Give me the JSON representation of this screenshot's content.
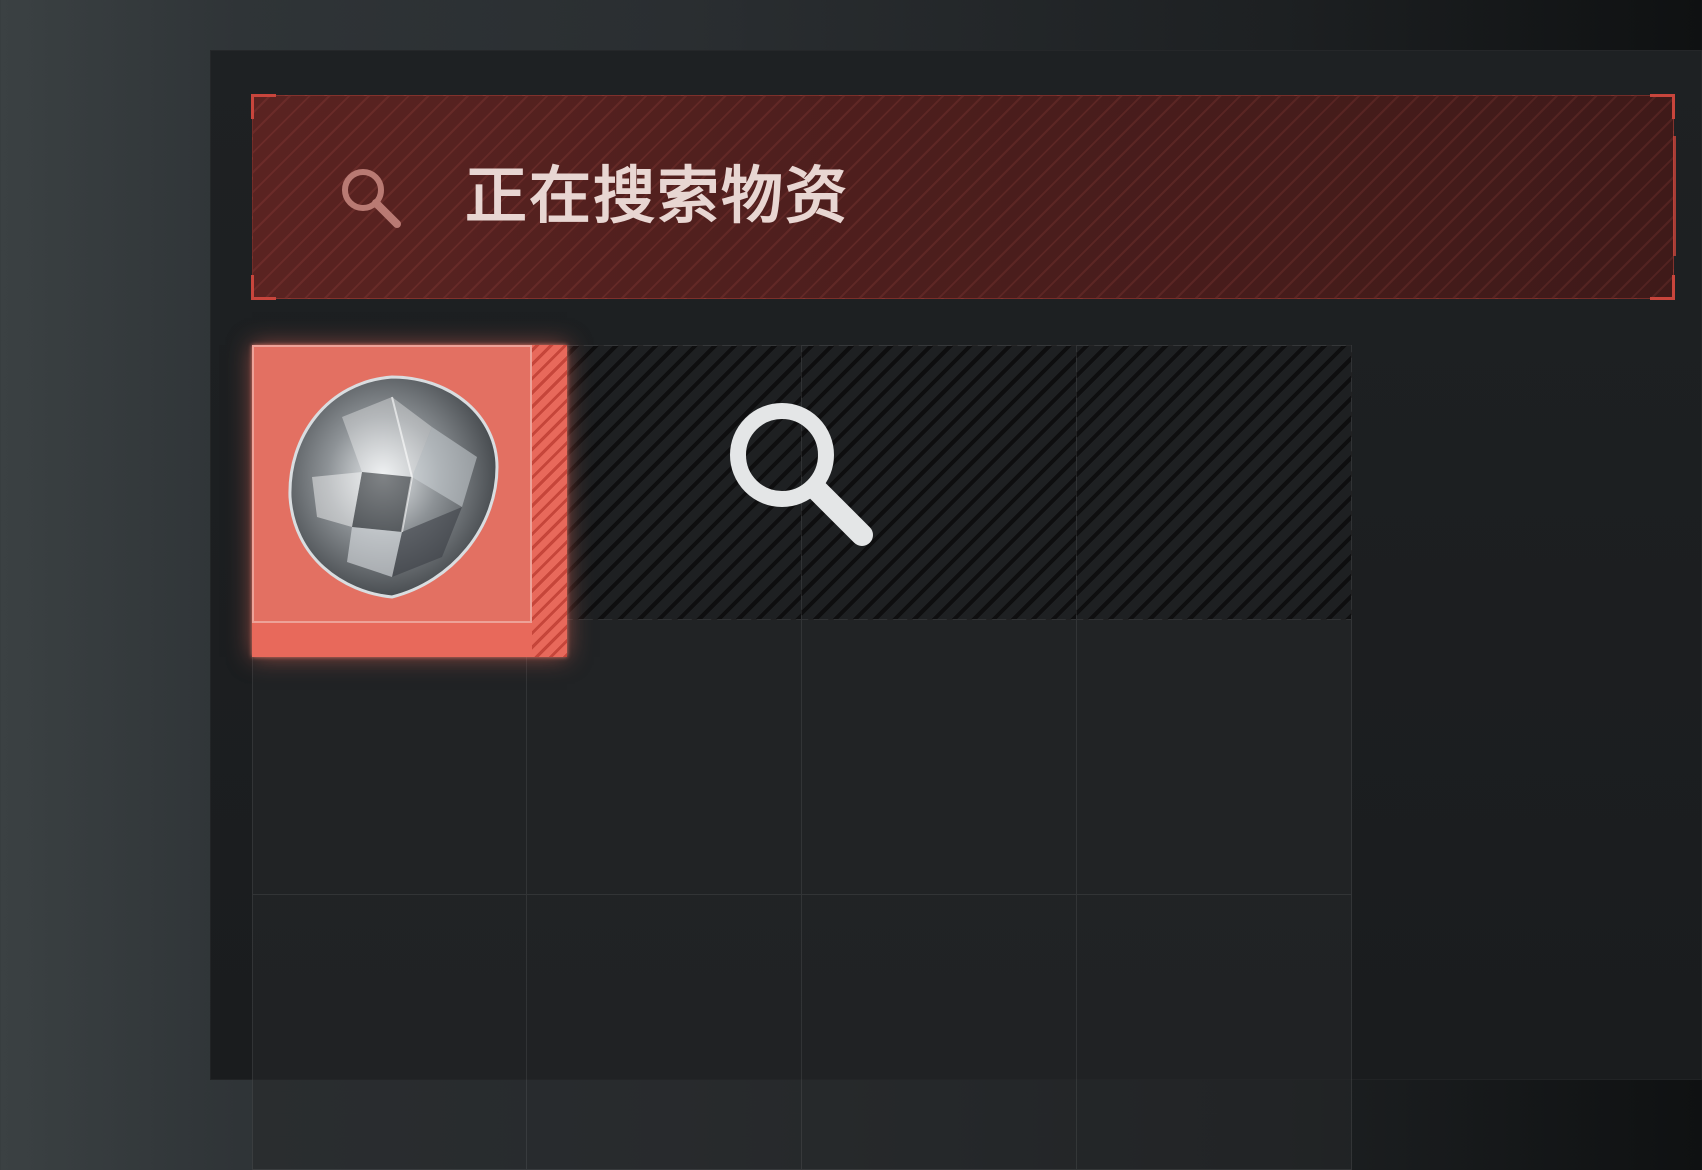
{
  "header": {
    "title": "正在搜索物资",
    "icon": "search-icon"
  },
  "container": {
    "columns": 4,
    "rows_visible": 3,
    "searching_slots": 3
  },
  "item": {
    "icon": "diamond-icon",
    "rarity_color": "#e8695b"
  },
  "status": {
    "icon": "search-icon",
    "state": "searching"
  },
  "colors": {
    "accent": "#c8453c",
    "header_bg": "#4a1c1c",
    "item_highlight": "#e8695b"
  }
}
